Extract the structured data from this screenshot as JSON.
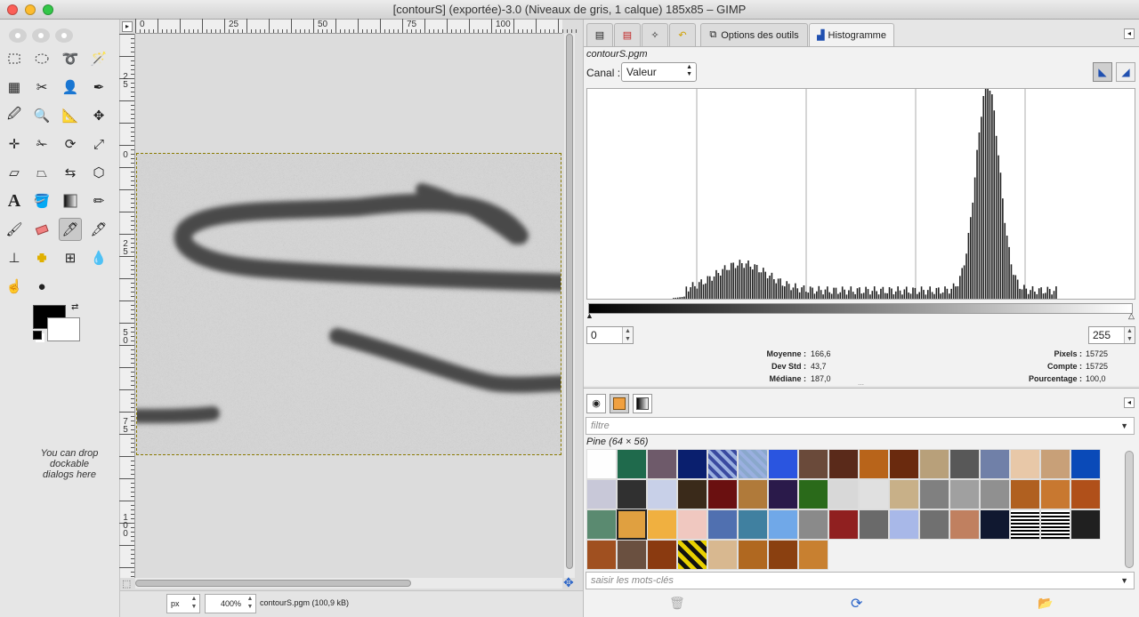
{
  "window": {
    "title": "[contourS] (exportée)-3.0 (Niveaux de gris, 1 calque) 185x85 – GIMP"
  },
  "toolbox": {
    "drop_note": "You can drop dockable dialogs here"
  },
  "ruler": {
    "h_labels": [
      "0",
      "25",
      "50",
      "75",
      "100"
    ],
    "v_labels": [
      "2\n5",
      "0",
      "2\n5",
      "5\n0",
      "7\n5",
      "1\n0\n0"
    ]
  },
  "status": {
    "unit": "px",
    "zoom": "400%",
    "file": "contourS.pgm (100,9 kB)"
  },
  "histogram_panel": {
    "tabs": [
      "Options des outils",
      "Histogramme"
    ],
    "filename": "contourS.pgm",
    "canal_label": "Canal :",
    "canal_value": "Valeur",
    "range_min": "0",
    "range_max": "255",
    "stats_left": [
      {
        "label": "Moyenne :",
        "value": "166,6"
      },
      {
        "label": "Dev Std :",
        "value": "43,7"
      },
      {
        "label": "Médiane :",
        "value": "187,0"
      }
    ],
    "stats_right": [
      {
        "label": "Pixels :",
        "value": "15725"
      },
      {
        "label": "Compte :",
        "value": "15725"
      },
      {
        "label": "Pourcentage :",
        "value": "100,0"
      }
    ]
  },
  "patterns_panel": {
    "filter_placeholder": "filtre",
    "selected_label": "Pine (64 × 56)",
    "tags_placeholder": "saisir les mots-clés",
    "swatches": [
      "#fefefe",
      "#1f6a4c",
      "#6e5a6a",
      "#0a1f6e",
      "#3a4aa0",
      "#8aa8cc",
      "#2a55e0",
      "#6a4a3a",
      "#5a2a1a",
      "#b8641a",
      "#6a2a0e",
      "#b8a07a",
      "#585858",
      "#7080a8",
      "#e8c8a8",
      "#c8a078",
      "#0a4ab8",
      "#c8c8d8",
      "#303030",
      "#c8d0e8",
      "#3a2a1a",
      "#6a1010",
      "#b07a3a",
      "#2a1a4a",
      "#2a6a1a",
      "#d8d8d8",
      "#e0e0e0",
      "#c8b088",
      "#808080",
      "#a0a0a0",
      "#909090",
      "#b06020",
      "#c87830",
      "#b0501a",
      "#5a8a70",
      "#e0a040",
      "#f0b040",
      "#f0c8c0",
      "#5070b0",
      "#4080a0",
      "#70a8e8",
      "#8a8a8a",
      "#902020",
      "#6a6a6a",
      "#a8b8e8",
      "#707070",
      "#c08060",
      "#101830",
      "#506080",
      "#202020",
      "#202020",
      "#a05020",
      "#6a5040",
      "#8a3a10",
      "#e8d000",
      "#d8b890",
      "#b06820",
      "#8a4010",
      "#c88030"
    ],
    "selected_index": 35
  },
  "colors": {
    "fg": "#000000",
    "bg": "#ffffff"
  }
}
